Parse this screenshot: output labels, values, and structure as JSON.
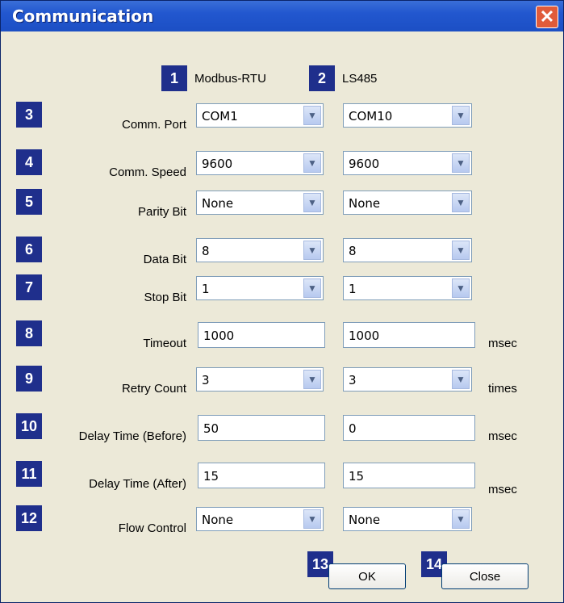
{
  "window": {
    "title": "Communication"
  },
  "columns": {
    "col1": {
      "badge": "1",
      "label": "Modbus-RTU"
    },
    "col2": {
      "badge": "2",
      "label": "LS485"
    }
  },
  "rows": [
    {
      "badge": "3",
      "label": "Comm. Port",
      "type": "combo",
      "v1": "COM1",
      "v2": "COM10",
      "unit": ""
    },
    {
      "badge": "4",
      "label": "Comm. Speed",
      "type": "combo",
      "v1": "9600",
      "v2": "9600",
      "unit": ""
    },
    {
      "badge": "5",
      "label": "Parity Bit",
      "type": "combo",
      "v1": "None",
      "v2": "None",
      "unit": ""
    },
    {
      "badge": "6",
      "label": "Data Bit",
      "type": "combo",
      "v1": "8",
      "v2": "8",
      "unit": ""
    },
    {
      "badge": "7",
      "label": "Stop Bit",
      "type": "combo",
      "v1": "1",
      "v2": "1",
      "unit": ""
    },
    {
      "badge": "8",
      "label": "Timeout",
      "type": "input",
      "v1": "1000",
      "v2": "1000",
      "unit": "msec"
    },
    {
      "badge": "9",
      "label": "Retry Count",
      "type": "combo",
      "v1": "3",
      "v2": "3",
      "unit": "times"
    },
    {
      "badge": "10",
      "label": "Delay Time (Before)",
      "type": "input",
      "v1": "50",
      "v2": "0",
      "unit": "msec"
    },
    {
      "badge": "11",
      "label": "Delay Time (After)",
      "type": "input",
      "v1": "15",
      "v2": "15",
      "unit": "msec"
    },
    {
      "badge": "12",
      "label": "Flow Control",
      "type": "combo",
      "v1": "None",
      "v2": "None",
      "unit": ""
    }
  ],
  "buttons": {
    "ok": {
      "badge": "13",
      "label": "OK"
    },
    "close": {
      "badge": "14",
      "label": "Close"
    }
  },
  "icons": {
    "close": "close-icon",
    "dropdown": "chevron-down-icon"
  }
}
